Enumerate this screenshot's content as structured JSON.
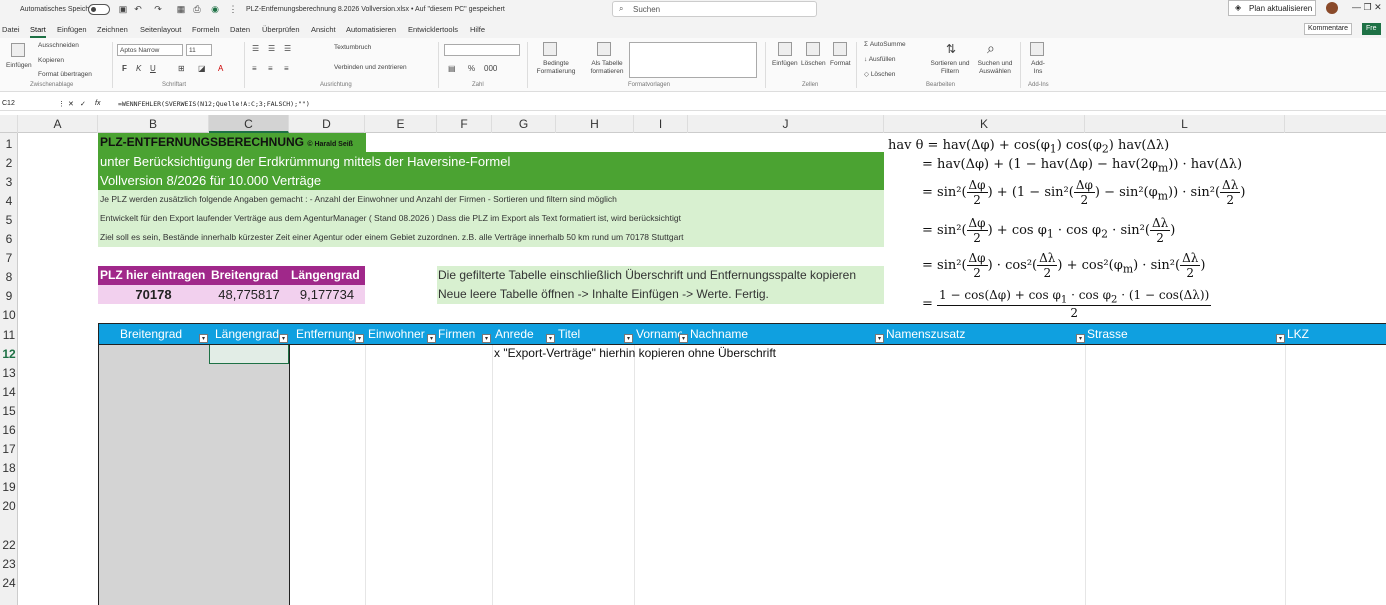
{
  "titlebar": {
    "autosave": "Automatisches Speichern",
    "filename": "PLZ-Entfernungsberechnung 8.2026 Vollversion.xlsx • Auf \"diesem PC\" gespeichert",
    "search_placeholder": "Suchen",
    "plan_button": "Plan aktualisieren",
    "window_controls": "—  ❐  ✕"
  },
  "menu": {
    "items": [
      "Datei",
      "Start",
      "Einfügen",
      "Zeichnen",
      "Seitenlayout",
      "Formeln",
      "Daten",
      "Überprüfen",
      "Ansicht",
      "Automatisieren",
      "Entwicklertools",
      "Hilfe"
    ],
    "comments": "Kommentare",
    "share": "Fre"
  },
  "ribbon": {
    "paste": "Einfügen",
    "cut": "Ausschneiden",
    "copy": "Kopieren",
    "format_painter": "Format übertragen",
    "font_name": "Aptos Narrow",
    "font_size": "11",
    "wrap": "Textumbruch",
    "merge": "Verbinden und zentrieren",
    "cond_format": "Bedingte Formatierung",
    "as_table": "Als Tabelle formatieren",
    "insert": "Einfügen",
    "delete": "Löschen",
    "format": "Format",
    "autosum": "AutoSumme",
    "fill": "Ausfüllen",
    "clear": "Löschen",
    "sort_filter": "Sortieren und Filtern",
    "find_select": "Suchen und Auswählen",
    "addins": "Add-Ins",
    "groups": [
      "Zwischenablage",
      "Schriftart",
      "Ausrichtung",
      "Zahl",
      "Formatvorlagen",
      "Zellen",
      "Bearbeiten",
      "Add-Ins"
    ]
  },
  "formula": {
    "cell_ref": "C12",
    "fx": "fx",
    "content": "=WENNFEHLER(SVERWEIS(N12;Quelle!A:C;3;FALSCH);\"\")"
  },
  "columns": [
    "A",
    "B",
    "C",
    "D",
    "E",
    "F",
    "G",
    "H",
    "I",
    "J",
    "K",
    "L"
  ],
  "rows": [
    "1",
    "2",
    "3",
    "4",
    "5",
    "6",
    "7",
    "8",
    "9",
    "10",
    "11",
    "12",
    "13",
    "14",
    "15",
    "16",
    "17",
    "18",
    "19",
    "20",
    "22",
    "23",
    "24"
  ],
  "sheet": {
    "title": "PLZ-ENTFERNUNGSBERECHNUNG",
    "copyright": "© Harald Seiß",
    "subtitle": "unter Berücksichtigung der Erdkrümmung mittels der Haversine-Formel",
    "version": "Vollversion 8/2026 für 10.000 Verträge",
    "info1": "Je PLZ werden zusätzlich folgende Angaben gemacht :  - Anzahl der Einwohner und Anzahl der Firmen  - Sortieren und filtern sind möglich",
    "info2": "Entwickelt für den Export laufender Verträge aus dem AgenturManager ( Stand 08.2026 )  Dass die PLZ im Export als Text formatiert ist, wird berücksichtigt",
    "info3": "Ziel soll es sein,  Bestände innerhalb kürzester Zeit einer Agentur oder einem Gebiet zuzordnen. z.B. alle Verträge innerhalb 50 km rund um 70178 Stuttgart",
    "plz_label": "PLZ hier eintragen",
    "lat_label": "Breitengrad",
    "lon_label": "Längengrad",
    "plz_value": "70178",
    "lat_value": "48,775817",
    "lon_value": "9,177734",
    "instr1": "Die gefilterte Tabelle einschließlich  Überschrift und Entfernungsspalte kopieren",
    "instr2": "Neue leere Tabelle öffnen -> Inhalte Einfügen -> Werte.  Fertig.",
    "table_headers": [
      "Breitengrad",
      "Längengrad",
      "Entfernung",
      "Einwohner",
      "Firmen",
      "Anrede",
      "Titel",
      "Vorname",
      "Nachname",
      "Namenszusatz",
      "Strasse",
      "LKZ"
    ],
    "paste_hint": "x \"Export-Verträge\" hierhin kopieren ohne Überschrift"
  }
}
